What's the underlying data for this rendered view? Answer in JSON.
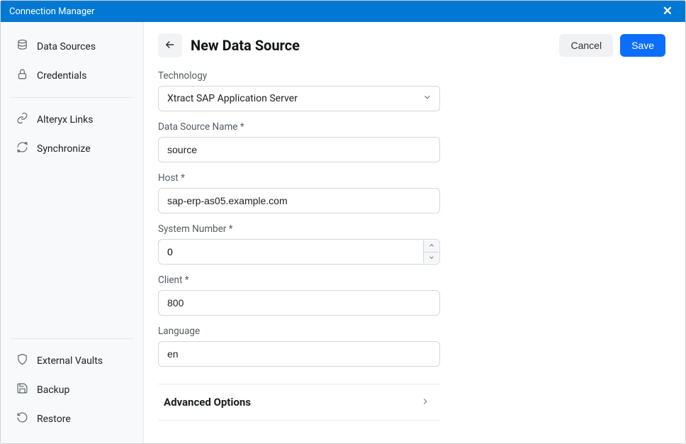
{
  "titlebar": {
    "title": "Connection Manager"
  },
  "sidebar": {
    "top": [
      {
        "id": "datasources",
        "label": "Data Sources",
        "icon": "database-icon"
      },
      {
        "id": "credentials",
        "label": "Credentials",
        "icon": "lock-icon"
      }
    ],
    "mid": [
      {
        "id": "alteryx-links",
        "label": "Alteryx Links",
        "icon": "link-icon"
      },
      {
        "id": "synchronize",
        "label": "Synchronize",
        "icon": "sync-icon"
      }
    ],
    "bottom": [
      {
        "id": "external-vaults",
        "label": "External Vaults",
        "icon": "shield-icon"
      },
      {
        "id": "backup",
        "label": "Backup",
        "icon": "save-icon"
      },
      {
        "id": "restore",
        "label": "Restore",
        "icon": "restore-icon"
      }
    ]
  },
  "header": {
    "title": "New Data Source",
    "cancel": "Cancel",
    "save": "Save"
  },
  "form": {
    "technology_label": "Technology",
    "technology_value": "Xtract SAP Application Server",
    "datasource_name_label": "Data Source Name *",
    "datasource_name_value": "source",
    "host_label": "Host *",
    "host_value": "sap-erp-as05.example.com",
    "system_number_label": "System Number *",
    "system_number_value": "0",
    "client_label": "Client *",
    "client_value": "800",
    "language_label": "Language",
    "language_value": "en",
    "advanced_label": "Advanced Options"
  }
}
